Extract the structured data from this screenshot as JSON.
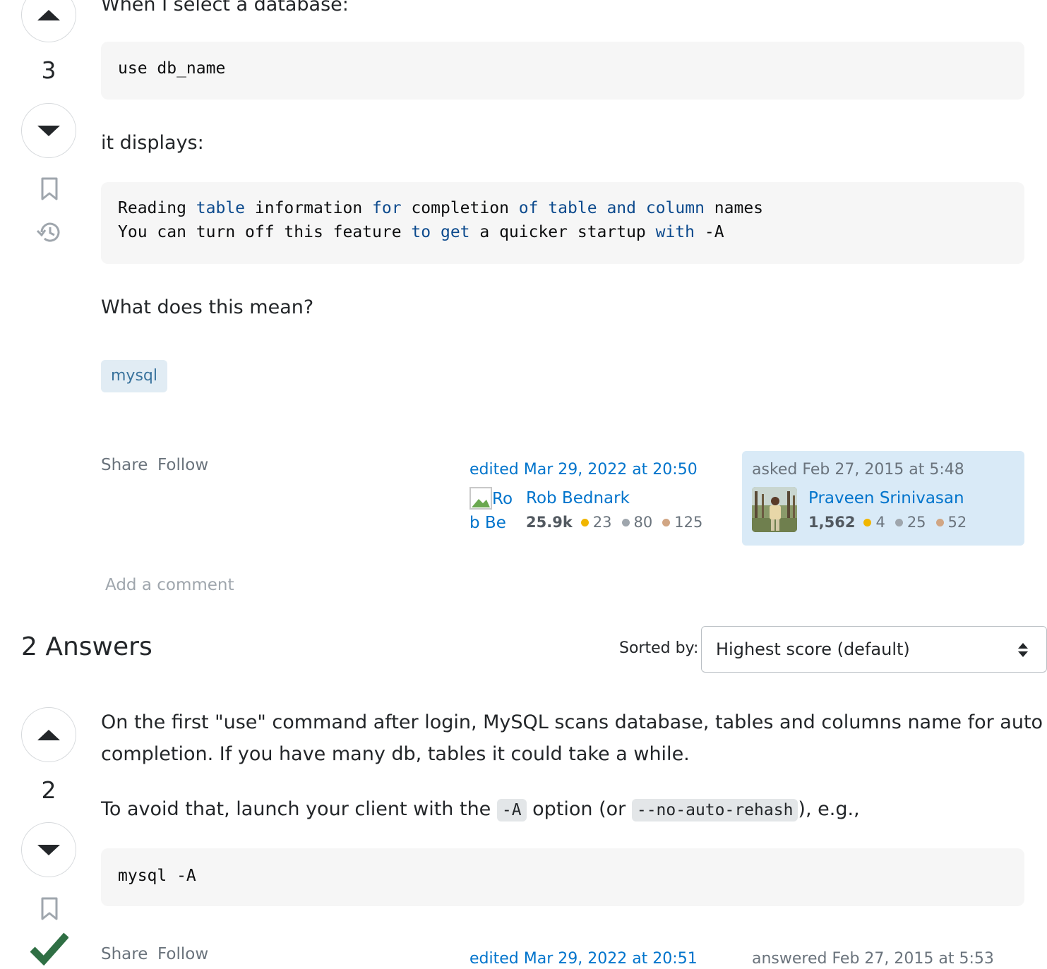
{
  "question": {
    "intro_text": "When I select a database:",
    "code1": "use db_name",
    "displays_text": "it displays:",
    "output_lines": [
      [
        {
          "t": "Reading ",
          "k": false
        },
        {
          "t": "table",
          "k": true
        },
        {
          "t": " information ",
          "k": false
        },
        {
          "t": "for",
          "k": true
        },
        {
          "t": " completion ",
          "k": false
        },
        {
          "t": "of",
          "k": true
        },
        {
          "t": " ",
          "k": false
        },
        {
          "t": "table",
          "k": true
        },
        {
          "t": " ",
          "k": false
        },
        {
          "t": "and",
          "k": true
        },
        {
          "t": " ",
          "k": false
        },
        {
          "t": "column",
          "k": true
        },
        {
          "t": " names",
          "k": false
        }
      ],
      [
        {
          "t": "You can turn off this feature ",
          "k": false
        },
        {
          "t": "to",
          "k": true
        },
        {
          "t": " ",
          "k": false
        },
        {
          "t": "get",
          "k": true
        },
        {
          "t": " a quicker startup ",
          "k": false
        },
        {
          "t": "with",
          "k": true
        },
        {
          "t": " -A",
          "k": false
        }
      ]
    ],
    "question_text": "What does this mean?",
    "tag": "mysql",
    "score": "3",
    "share_label": "Share",
    "follow_label": "Follow",
    "edited": "edited Mar 29, 2022 at 20:50",
    "editor": {
      "name": "Rob Bednark",
      "avatar_alt": "Rob Bednark",
      "rep": "25.9k",
      "gold": "23",
      "silver": "80",
      "bronze": "125"
    },
    "asked": "asked Feb 27, 2015 at 5:48",
    "owner": {
      "name": "Praveen Srinivasan",
      "rep": "1,562",
      "gold": "4",
      "silver": "25",
      "bronze": "52"
    },
    "add_comment": "Add a comment"
  },
  "answers_header": {
    "title": "2 Answers",
    "sorted_by_label": "Sorted by:",
    "sort_value": "Highest score (default)"
  },
  "answer": {
    "score": "2",
    "para1_line1": "On the first \"use\" command after login, MySQL scans database, tables and columns name for auto",
    "para1_line2": "completion. If you have many db, tables it could take a while.",
    "para2_a": "To avoid that, launch your client with the ",
    "para2_code1": "-A",
    "para2_b": " option (or ",
    "para2_code2": "--no-auto-rehash",
    "para2_c": "), e.g.,",
    "code": "mysql -A",
    "share_label": "Share",
    "follow_label": "Follow",
    "edited": "edited Mar 29, 2022 at 20:51",
    "answered": "answered Feb 27, 2015 at 5:53"
  },
  "colors": {
    "gold": "#f1b600",
    "silver": "#9fa6ad",
    "bronze": "#d1a684",
    "link": "#0074cc",
    "accept": "#2f6f44"
  }
}
